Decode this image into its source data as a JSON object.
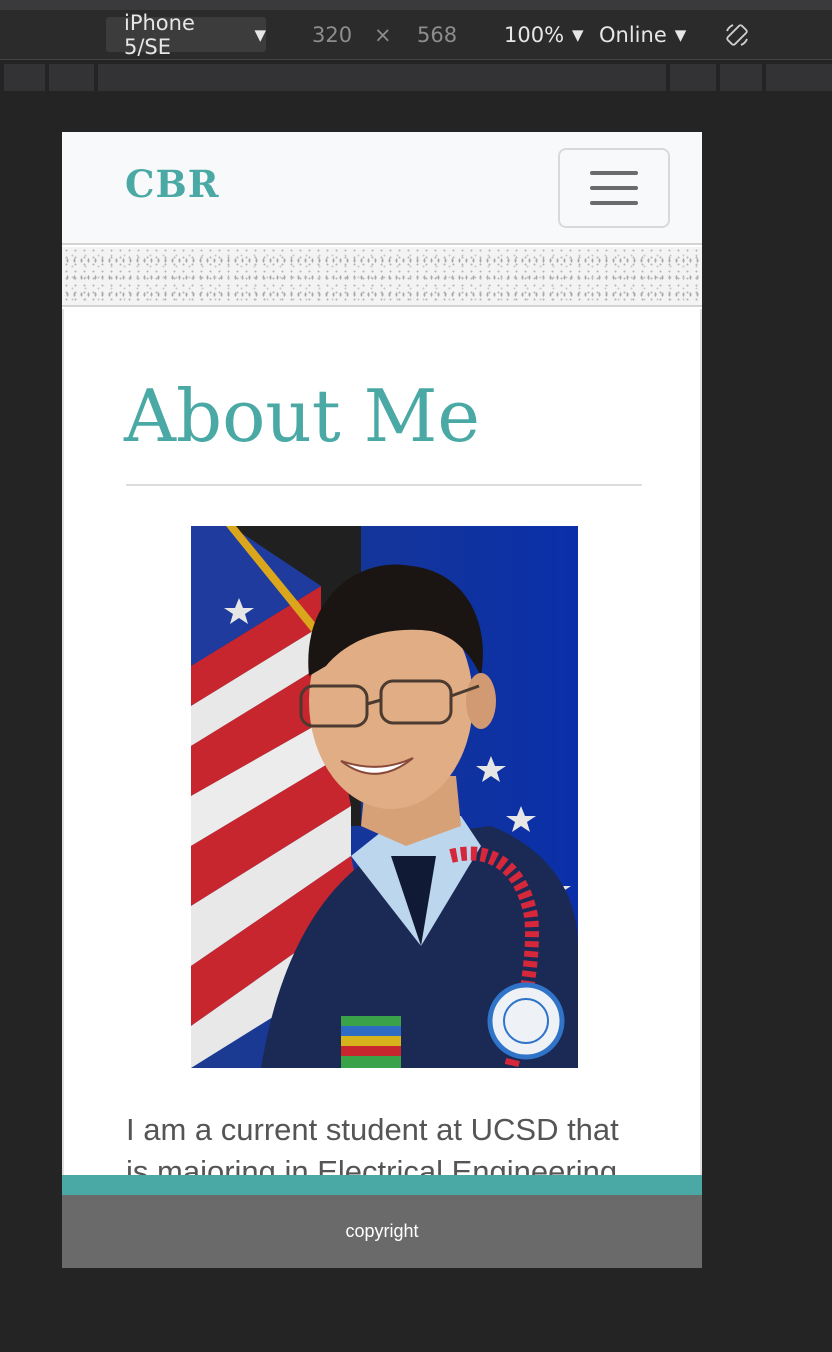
{
  "devtools": {
    "device": "iPhone 5/SE",
    "width": "320",
    "times": "×",
    "height": "568",
    "zoom": "100%",
    "network": "Online",
    "rotate_icon": "rotate-device-icon"
  },
  "site": {
    "brand": "CBR",
    "menu_icon": "hamburger-menu-icon",
    "heading": "About Me",
    "photo_alt": "Portrait photo",
    "bio_line1": "I am a current student at UCSD that",
    "bio_line2": "is majoring in Electrical Engineering",
    "footer": "copyright"
  },
  "colors": {
    "accent": "#4aa9a4",
    "footer_bg": "#6a6a6a",
    "navbar_bg": "#f8f9fa"
  }
}
